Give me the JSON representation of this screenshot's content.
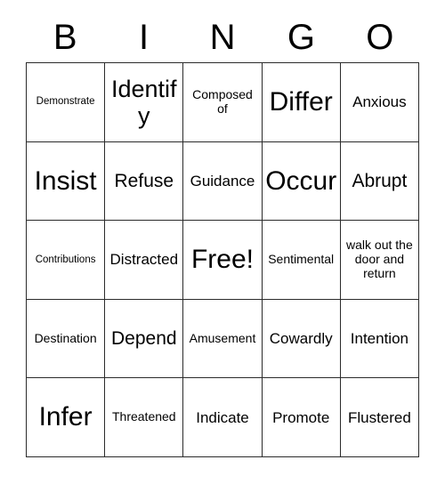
{
  "card": {
    "headers": [
      "B",
      "I",
      "N",
      "G",
      "O"
    ],
    "rows": [
      [
        {
          "text": "Demonstrate",
          "size": "s-xs"
        },
        {
          "text": "Identify",
          "size": "s-xl"
        },
        {
          "text": "Composed of",
          "size": "s-sm"
        },
        {
          "text": "Differ",
          "size": "s-xxl"
        },
        {
          "text": "Anxious",
          "size": "s-md"
        }
      ],
      [
        {
          "text": "Insist",
          "size": "s-xxl"
        },
        {
          "text": "Refuse",
          "size": "s-lg"
        },
        {
          "text": "Guidance",
          "size": "s-md"
        },
        {
          "text": "Occur",
          "size": "s-xxl"
        },
        {
          "text": "Abrupt",
          "size": "s-lg"
        }
      ],
      [
        {
          "text": "Contributions",
          "size": "s-xs"
        },
        {
          "text": "Distracted",
          "size": "s-md"
        },
        {
          "text": "Free!",
          "size": "s-xxl"
        },
        {
          "text": "Sentimental",
          "size": "s-sm"
        },
        {
          "text": "walk out the door and return",
          "size": "s-sm"
        }
      ],
      [
        {
          "text": "Destination",
          "size": "s-sm"
        },
        {
          "text": "Depend",
          "size": "s-lg"
        },
        {
          "text": "Amusement",
          "size": "s-sm"
        },
        {
          "text": "Cowardly",
          "size": "s-md"
        },
        {
          "text": "Intention",
          "size": "s-md"
        }
      ],
      [
        {
          "text": "Infer",
          "size": "s-xxl"
        },
        {
          "text": "Threatened",
          "size": "s-sm"
        },
        {
          "text": "Indicate",
          "size": "s-md"
        },
        {
          "text": "Promote",
          "size": "s-md"
        },
        {
          "text": "Flustered",
          "size": "s-md"
        }
      ]
    ]
  },
  "colors": {
    "grid_line": "#2b2b2b",
    "text": "#000000",
    "background": "#ffffff"
  }
}
